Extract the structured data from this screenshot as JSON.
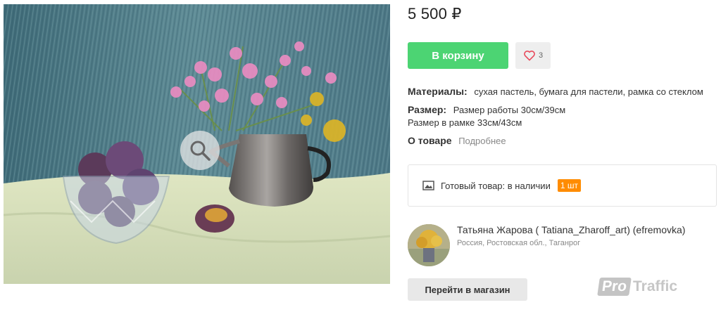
{
  "product": {
    "image_alt": "painting-still-life",
    "zoom_icon": "magnifier-icon"
  },
  "price": "5 500 ₽",
  "cart_button": "В корзину",
  "favorite": {
    "icon": "heart-icon",
    "count": "3"
  },
  "details": {
    "materials_label": "Материалы:",
    "materials_value": "сухая пастель, бумага для пастели, рамка со стеклом",
    "size_label": "Размер:",
    "size_value_1": "Размер работы 30см/39см",
    "size_value_2": "Размер в рамке 33см/43см",
    "about_label": "О товаре",
    "about_link": "Подробнее"
  },
  "stock": {
    "icon": "image-icon",
    "text": "Готовый товар: в наличии",
    "quantity": "1 шт",
    "quantity_color": "#ff8c00"
  },
  "seller": {
    "name": "Татьяна Жарова ( Tatiana_Zharoff_art) (efremovka)",
    "location": "Россия, Ростовская обл., Таганрог"
  },
  "shop_button": "Перейти в магазин",
  "watermark": {
    "pro": "Pro",
    "traffic": "Traffic"
  },
  "colors": {
    "accent_green": "#4cd473",
    "badge_orange": "#ff8c00"
  }
}
